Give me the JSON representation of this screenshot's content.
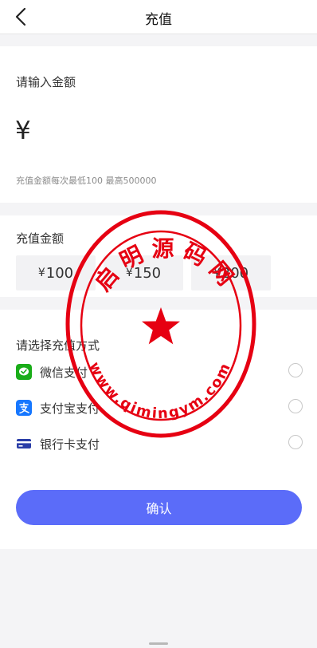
{
  "header": {
    "title": "充值"
  },
  "input_section": {
    "label": "请输入金额",
    "currency_symbol": "¥",
    "hint": "充值金额每次最低100  最高500000"
  },
  "amount_section": {
    "label": "充值金额",
    "currency": "¥",
    "options": [
      {
        "value": "100"
      },
      {
        "value": "150"
      },
      {
        "value": "200"
      }
    ]
  },
  "payment_section": {
    "label": "请选择充值方式",
    "methods": [
      {
        "label": "微信支付",
        "icon": "wechat-pay-icon",
        "color": "#1aad19"
      },
      {
        "label": "支付宝支付",
        "icon": "alipay-icon",
        "color": "#1677ff"
      },
      {
        "label": "银行卡支付",
        "icon": "bank-card-icon",
        "color": "#2b3ea8"
      }
    ]
  },
  "confirm_label": "确认",
  "colors": {
    "accent": "#5b6cf9",
    "stamp": "#e60012"
  },
  "watermark": {
    "top_text": "启明源码网",
    "bottom_text": "www.qimingym.com"
  }
}
